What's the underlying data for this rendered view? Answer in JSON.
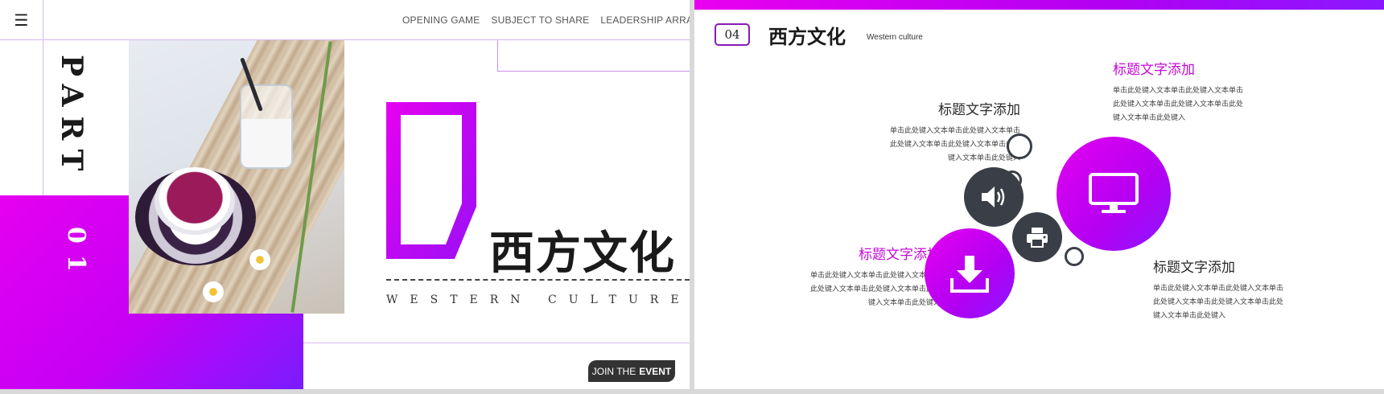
{
  "left_slide": {
    "nav": [
      "OPENING GAME",
      "SUBJECT TO SHARE",
      "LEADERSHIP ARRANGEMENT"
    ],
    "part_label": "PART",
    "part_number": "01",
    "title_cn": "西方文化",
    "subtitle_en": "WESTERN CULTURE",
    "join_button": {
      "prefix": "JOIN THE",
      "emphasis": "EVENT"
    },
    "icons": {
      "menu": "hamburger-menu-icon"
    },
    "colors": {
      "accent": "#d400f0",
      "accent_deep": "#7a1cff",
      "dark": "#333333"
    }
  },
  "right_slide": {
    "number": "04",
    "title": "西方文化",
    "subtitle": "Western culture",
    "blocks": [
      {
        "heading": "标题文字添加",
        "lines": [
          "单击此处键入文本单击此处键入文本单击",
          "此处键入文本单击此处键入文本单击此处",
          "键入文本单击此处键入"
        ]
      },
      {
        "heading": "标题文字添加",
        "lines": [
          "单击此处键入文本单击此处键入文本单击",
          "此处键入文本单击此处键入文本单击此处",
          "键入文本单击此处键入"
        ]
      },
      {
        "heading": "标题文字添加",
        "lines": [
          "单击此处键入文本单击此处键入文本单击",
          "此处键入文本单击此处键入文本单击此处",
          "键入文本单击此处键入"
        ]
      },
      {
        "heading": "标题文字添加",
        "lines": [
          "单击此处键入文本单击此处键入文本单击",
          "此处键入文本单击此处键入文本单击此处",
          "键入文本单击此处键入"
        ]
      }
    ],
    "icons": {
      "monitor": "monitor-icon",
      "speaker": "speaker-icon",
      "printer": "printer-icon",
      "download": "download-icon"
    },
    "colors": {
      "accent": "#c40ad8",
      "circle_dark": "#3a3f47"
    }
  }
}
